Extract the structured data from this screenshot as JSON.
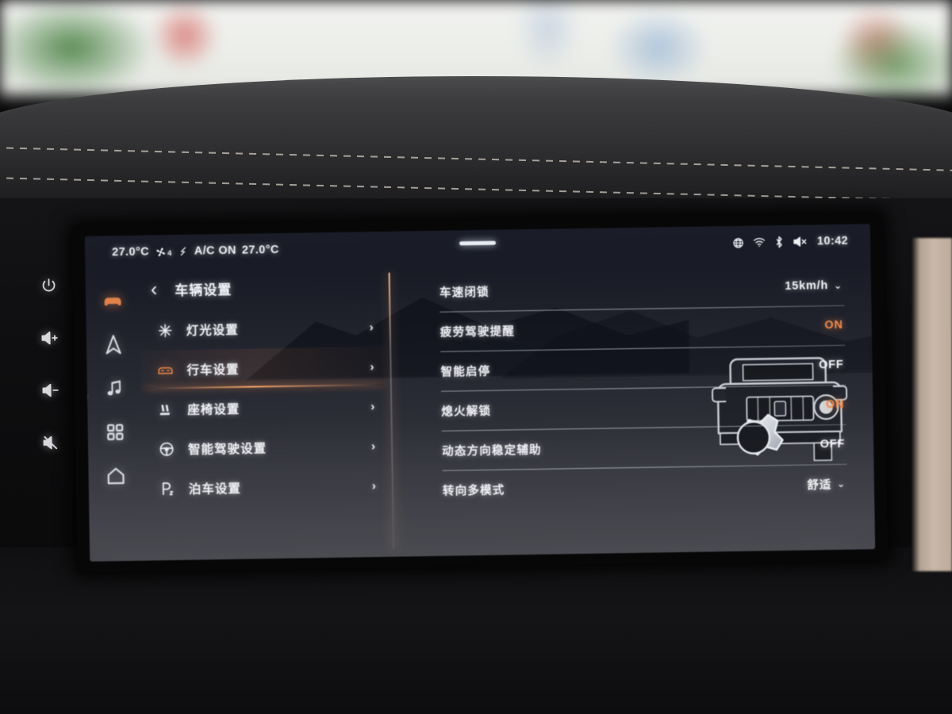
{
  "status_bar": {
    "temp_left": "27.0°C",
    "fan_level": "4",
    "fan_icon": "fan-icon",
    "airflow_icon": "airflow-icon",
    "ac_status": "A/C ON",
    "temp_right": "27.0°C",
    "handle_icon": "pull-handle",
    "sys_icons": [
      "globe-icon",
      "wifi-icon",
      "bluetooth-icon",
      "mute-speaker-icon"
    ],
    "clock": "10:42"
  },
  "nav_rail": {
    "items": [
      {
        "name": "nav-car",
        "icon": "car-icon",
        "active": true
      },
      {
        "name": "nav-navigation",
        "icon": "navigation-icon",
        "active": false
      },
      {
        "name": "nav-music",
        "icon": "music-icon",
        "active": false
      },
      {
        "name": "nav-apps",
        "icon": "apps-grid-icon",
        "active": false
      },
      {
        "name": "nav-home",
        "icon": "home-icon",
        "active": false
      }
    ]
  },
  "menu": {
    "back_label": "‹",
    "title": "车辆设置",
    "items": [
      {
        "label": "灯光设置",
        "icon": "sun-light-icon",
        "chevron": "›",
        "active": false
      },
      {
        "label": "行车设置",
        "icon": "car-front-icon",
        "chevron": "›",
        "active": true
      },
      {
        "label": "座椅设置",
        "icon": "seat-icon",
        "chevron": "›",
        "active": false
      },
      {
        "label": "智能驾驶设置",
        "icon": "steering-wheel-icon",
        "chevron": "›",
        "active": false
      },
      {
        "label": "泊车设置",
        "icon": "parking-p-icon",
        "chevron": "›",
        "active": false
      }
    ]
  },
  "settings_rows": [
    {
      "label": "车速闭锁",
      "value": "15km/h",
      "type": "dropdown",
      "chevron": "⌄",
      "highlight": false
    },
    {
      "label": "疲劳驾驶提醒",
      "value": "ON",
      "type": "toggle",
      "chevron": "",
      "highlight": true
    },
    {
      "label": "智能启停",
      "value": "OFF",
      "type": "toggle",
      "chevron": "",
      "highlight": false
    },
    {
      "label": "熄火解锁",
      "value": "ON",
      "type": "toggle",
      "chevron": "",
      "highlight": true
    },
    {
      "label": "动态方向稳定辅助",
      "value": "OFF",
      "type": "toggle",
      "chevron": "",
      "highlight": false
    },
    {
      "label": "转向多模式",
      "value": "舒适",
      "type": "dropdown",
      "chevron": "⌄",
      "highlight": false
    }
  ],
  "artwork": {
    "name": "suv-with-gear-illustration",
    "vehicle_icon": "boxy-suv-front-icon",
    "overlay_icon": "gear-icon"
  },
  "physical_buttons": [
    {
      "name": "power-button",
      "icon": "power-icon"
    },
    {
      "name": "volume-up-button",
      "icon": "speaker-plus-icon"
    },
    {
      "name": "volume-down-button",
      "icon": "speaker-minus-icon"
    },
    {
      "name": "mute-button",
      "icon": "speaker-mute-icon"
    }
  ],
  "colors": {
    "accent": "#ef8a4e",
    "text": "#f0f2f6",
    "screen_bg_top": "#1a1d28",
    "screen_bg_bottom": "#45464c"
  }
}
